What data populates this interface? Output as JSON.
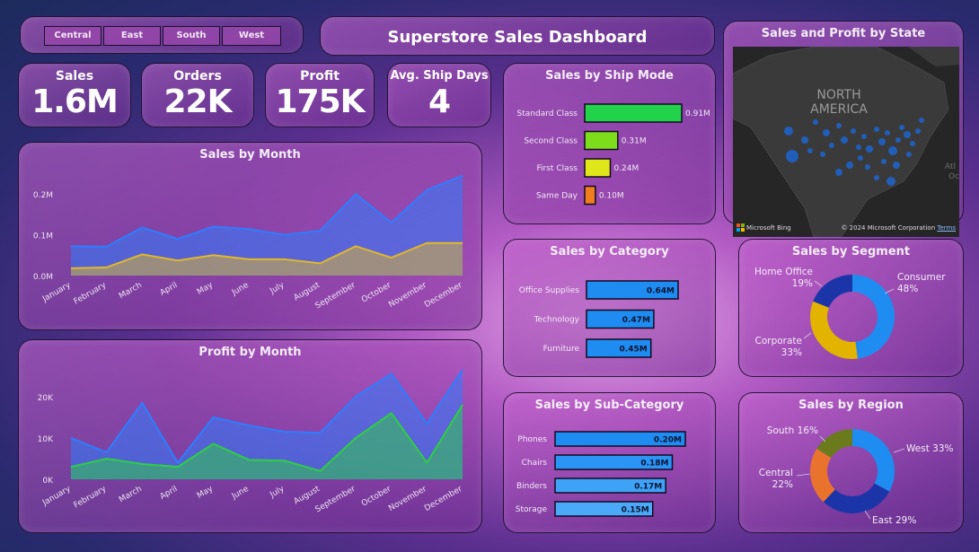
{
  "region_filter": {
    "items": [
      "Central",
      "East",
      "South",
      "West"
    ]
  },
  "dashboard_title": "Superstore Sales Dashboard",
  "kpis": [
    {
      "label": "Sales",
      "value": "1.6M"
    },
    {
      "label": "Orders",
      "value": "22K"
    },
    {
      "label": "Profit",
      "value": "175K"
    },
    {
      "label": "Avg. Ship Days",
      "value": "4"
    }
  ],
  "map": {
    "title": "Sales and Profit by State",
    "label_line1": "NORTH",
    "label_line2": "AMERICA",
    "side_label_1": "Atl",
    "side_label_2": "Oc",
    "bing_logo": "Microsoft Bing",
    "copyright": "© 2024 Microsoft Corporation",
    "terms_link": "Terms"
  },
  "colors": {
    "blue": "#2e7dff",
    "yellow": "#e0b82a",
    "green": "#2ed042",
    "donut_blue": "#1e8cf0",
    "donut_navy": "#1b35a8",
    "donut_yellow": "#e2b400",
    "donut_orange": "#e9722d",
    "donut_olive": "#6a7a1c"
  },
  "chart_data": [
    {
      "id": "sales_by_month",
      "type": "area",
      "title": "Sales by Month",
      "x": [
        "January",
        "February",
        "March",
        "April",
        "May",
        "June",
        "July",
        "August",
        "September",
        "October",
        "November",
        "December"
      ],
      "series": [
        {
          "values": [
            0.072,
            0.071,
            0.118,
            0.09,
            0.12,
            0.114,
            0.1,
            0.11,
            0.2,
            0.13,
            0.21,
            0.245
          ]
        },
        {
          "values": [
            0.018,
            0.02,
            0.052,
            0.037,
            0.05,
            0.04,
            0.04,
            0.03,
            0.072,
            0.044,
            0.08,
            0.08
          ]
        }
      ],
      "yticks": [
        "0.0M",
        "0.1M",
        "0.2M"
      ],
      "ylim": [
        0,
        0.26
      ]
    },
    {
      "id": "profit_by_month",
      "type": "area",
      "title": "Profit by Month",
      "x": [
        "January",
        "February",
        "March",
        "April",
        "May",
        "June",
        "July",
        "August",
        "September",
        "October",
        "November",
        "December"
      ],
      "series": [
        {
          "values": [
            10000,
            6500,
            18500,
            4000,
            15000,
            13000,
            11500,
            11300,
            20000,
            25500,
            13500,
            26500
          ]
        },
        {
          "values": [
            3000,
            5000,
            3700,
            3000,
            8600,
            4700,
            4500,
            2000,
            10000,
            16000,
            4000,
            18000
          ]
        }
      ],
      "yticks": [
        "0K",
        "10K",
        "20K"
      ],
      "ylim": [
        0,
        28000
      ]
    },
    {
      "id": "sales_by_ship_mode",
      "type": "bar",
      "title": "Sales by Ship Mode",
      "categories": [
        "Standard Class",
        "Second Class",
        "First Class",
        "Same Day"
      ],
      "values": [
        0.91,
        0.31,
        0.24,
        0.1
      ],
      "labels": [
        "0.91M",
        "0.31M",
        "0.24M",
        "0.10M"
      ],
      "colors": [
        "#22d24a",
        "#7ddc1c",
        "#dfe61a",
        "#ef7f1e"
      ]
    },
    {
      "id": "sales_by_category",
      "type": "bar",
      "title": "Sales by Category",
      "categories": [
        "Office Supplies",
        "Technology",
        "Furniture"
      ],
      "values": [
        0.64,
        0.47,
        0.45
      ],
      "labels": [
        "0.64M",
        "0.47M",
        "0.45M"
      ],
      "colors": [
        "#1e8cf0",
        "#1e8cf0",
        "#1e8cf0"
      ]
    },
    {
      "id": "sales_by_subcategory",
      "type": "bar",
      "title": "Sales by Sub-Category",
      "categories": [
        "Phones",
        "Chairs",
        "Binders",
        "Storage"
      ],
      "values": [
        0.2,
        0.18,
        0.17,
        0.15
      ],
      "labels": [
        "0.20M",
        "0.18M",
        "0.17M",
        "0.15M"
      ],
      "colors": [
        "#1e8cf0",
        "#2a95f5",
        "#3ea2f7",
        "#4aa9f9"
      ]
    },
    {
      "id": "sales_by_segment",
      "type": "pie",
      "title": "Sales by Segment",
      "categories": [
        "Consumer",
        "Corporate",
        "Home Office"
      ],
      "values": [
        48,
        33,
        19
      ],
      "labels": [
        [
          "Consumer",
          "48%"
        ],
        [
          "Corporate",
          "33%"
        ],
        [
          "Home Office",
          "19%"
        ]
      ],
      "colors": [
        "#1e8cf0",
        "#e2b400",
        "#1b35a8"
      ]
    },
    {
      "id": "sales_by_region",
      "type": "pie",
      "title": "Sales by Region",
      "categories": [
        "West",
        "East",
        "Central",
        "South"
      ],
      "values": [
        33,
        29,
        22,
        16
      ],
      "labels": [
        [
          "West 33%"
        ],
        [
          "East 29%"
        ],
        [
          "Central",
          "22%"
        ],
        [
          "South 16%"
        ]
      ],
      "colors": [
        "#1e8cf0",
        "#1b35a8",
        "#e9722d",
        "#6a7a1c"
      ]
    }
  ]
}
